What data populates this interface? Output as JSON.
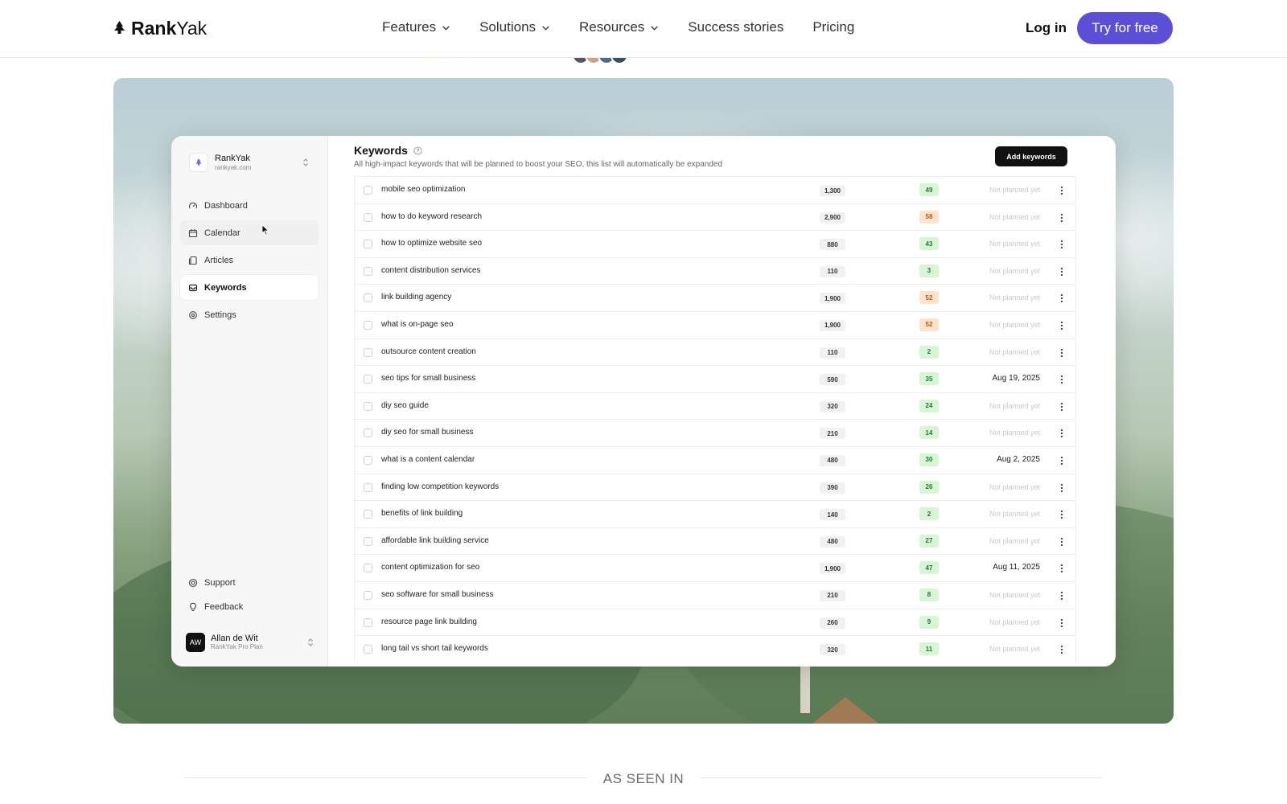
{
  "nav": {
    "brand_bold": "Rank",
    "brand_light": "Yak",
    "links": [
      "Features",
      "Solutions",
      "Resources",
      "Success stories",
      "Pricing"
    ],
    "login": "Log in",
    "cta": "Try for free",
    "cta_color": "#5b4fd6"
  },
  "app": {
    "workspace_name": "RankYak",
    "workspace_domain": "rankyak.com",
    "sidebar": [
      {
        "label": "Dashboard",
        "icon": "dashboard-icon"
      },
      {
        "label": "Calendar",
        "icon": "calendar-icon"
      },
      {
        "label": "Articles",
        "icon": "articles-icon"
      },
      {
        "label": "Keywords",
        "icon": "keywords-icon",
        "active": true
      },
      {
        "label": "Settings",
        "icon": "settings-icon"
      }
    ],
    "bottom": [
      {
        "label": "Support",
        "icon": "support-icon"
      },
      {
        "label": "Feedback",
        "icon": "feedback-icon"
      }
    ],
    "user": {
      "initials": "AW",
      "name": "Allan de Wit",
      "plan": "RankYak Pro Plan"
    },
    "title": "Keywords",
    "subtitle": "All high-impact keywords that will be planned to boost your SEO, this list will automatically be expanded",
    "add_button": "Add keywords",
    "rows": [
      {
        "keyword": "mobile seo optimization",
        "volume": "1,300",
        "difficulty": "49",
        "level": "green",
        "status": "Not planned yet"
      },
      {
        "keyword": "how to do keyword research",
        "volume": "2,900",
        "difficulty": "58",
        "level": "orange",
        "status": "Not planned yet"
      },
      {
        "keyword": "how to optimize website seo",
        "volume": "880",
        "difficulty": "43",
        "level": "green",
        "status": "Not planned yet"
      },
      {
        "keyword": "content distribution services",
        "volume": "110",
        "difficulty": "3",
        "level": "green",
        "status": "Not planned yet"
      },
      {
        "keyword": "link building agency",
        "volume": "1,900",
        "difficulty": "52",
        "level": "orange",
        "status": "Not planned yet"
      },
      {
        "keyword": "what is on-page seo",
        "volume": "1,900",
        "difficulty": "52",
        "level": "orange",
        "status": "Not planned yet"
      },
      {
        "keyword": "outsource content creation",
        "volume": "110",
        "difficulty": "2",
        "level": "green",
        "status": "Not planned yet"
      },
      {
        "keyword": "seo tips for small business",
        "volume": "590",
        "difficulty": "35",
        "level": "green",
        "status": "Aug 19, 2025",
        "planned": true
      },
      {
        "keyword": "diy seo guide",
        "volume": "320",
        "difficulty": "24",
        "level": "green",
        "status": "Not planned yet"
      },
      {
        "keyword": "diy seo for small business",
        "volume": "210",
        "difficulty": "14",
        "level": "green",
        "status": "Not planned yet"
      },
      {
        "keyword": "what is a content calendar",
        "volume": "480",
        "difficulty": "30",
        "level": "green",
        "status": "Aug 2, 2025",
        "planned": true
      },
      {
        "keyword": "finding low competition keywords",
        "volume": "390",
        "difficulty": "26",
        "level": "green",
        "status": "Not planned yet"
      },
      {
        "keyword": "benefits of link building",
        "volume": "140",
        "difficulty": "2",
        "level": "green",
        "status": "Not planned yet"
      },
      {
        "keyword": "affordable link building service",
        "volume": "480",
        "difficulty": "27",
        "level": "green",
        "status": "Not planned yet"
      },
      {
        "keyword": "content optimization for seo",
        "volume": "1,900",
        "difficulty": "47",
        "level": "green",
        "status": "Aug 11, 2025",
        "planned": true
      },
      {
        "keyword": "seo software for small business",
        "volume": "210",
        "difficulty": "8",
        "level": "green",
        "status": "Not planned yet"
      },
      {
        "keyword": "resource page link building",
        "volume": "260",
        "difficulty": "9",
        "level": "green",
        "status": "Not planned yet"
      },
      {
        "keyword": "long tail vs short tail keywords",
        "volume": "320",
        "difficulty": "11",
        "level": "green",
        "status": "Not planned yet"
      }
    ]
  },
  "seen_in": "AS SEEN IN"
}
